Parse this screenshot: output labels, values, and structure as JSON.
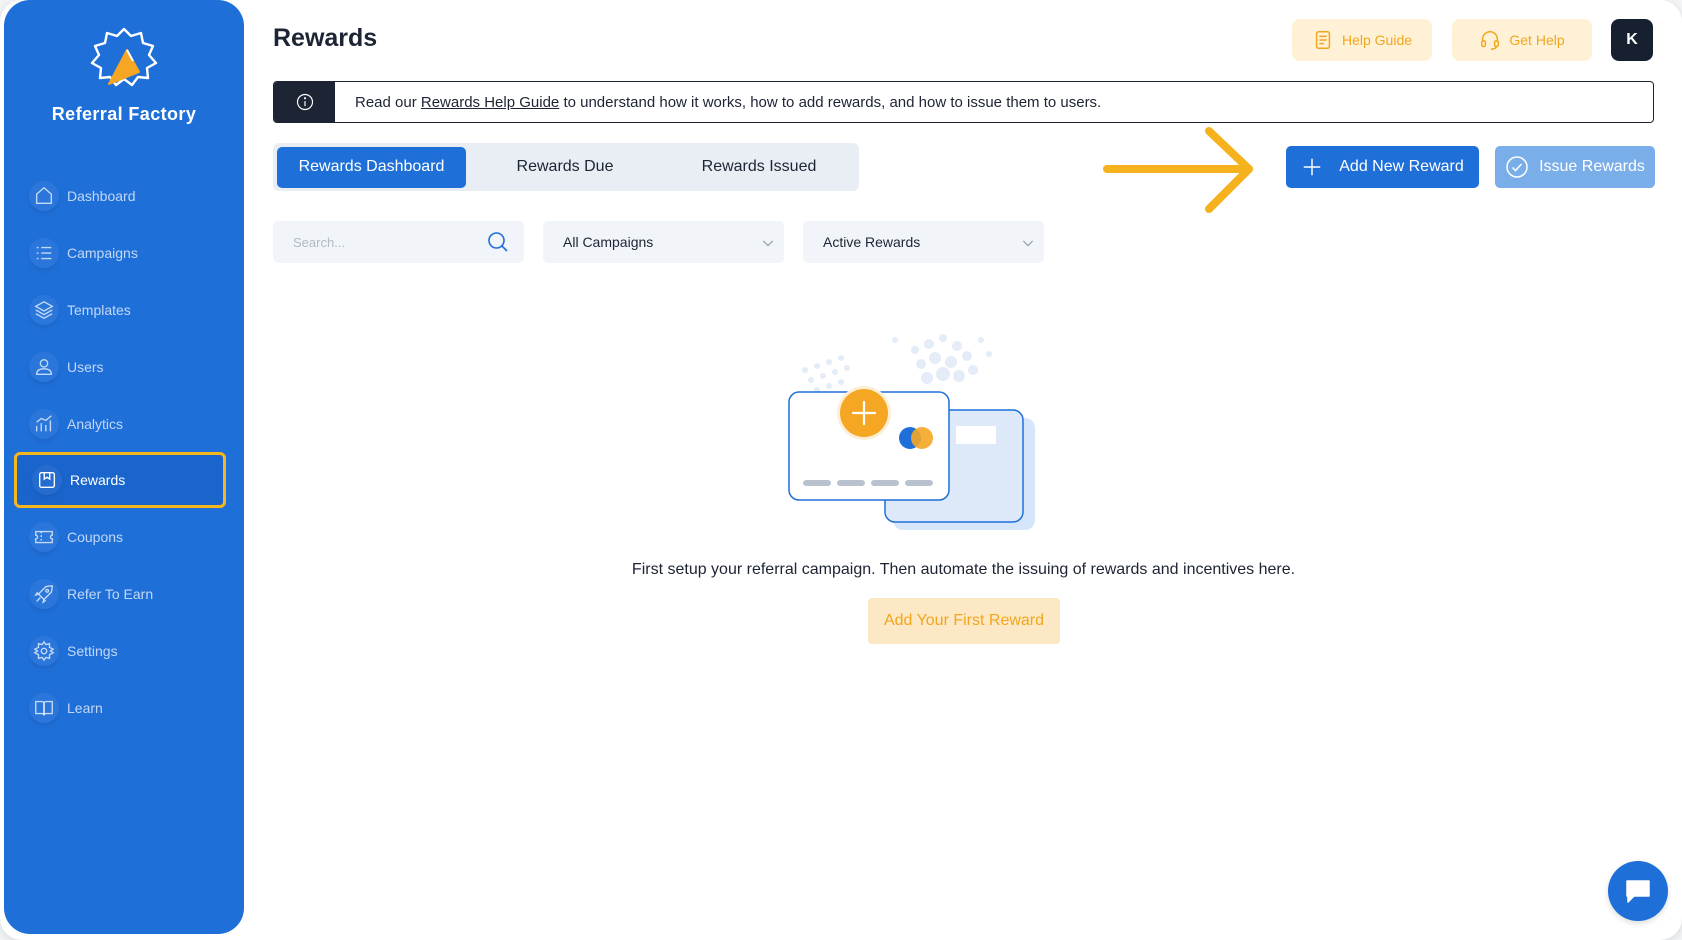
{
  "sidebar": {
    "brand": "Referral Factory",
    "items": [
      {
        "label": "Dashboard",
        "icon": "home-icon"
      },
      {
        "label": "Campaigns",
        "icon": "list-icon"
      },
      {
        "label": "Templates",
        "icon": "layers-icon"
      },
      {
        "label": "Users",
        "icon": "user-icon"
      },
      {
        "label": "Analytics",
        "icon": "chart-icon"
      },
      {
        "label": "Rewards",
        "icon": "gift-box-icon",
        "active": true
      },
      {
        "label": "Coupons",
        "icon": "ticket-icon"
      },
      {
        "label": "Refer To Earn",
        "icon": "rocket-icon"
      },
      {
        "label": "Settings",
        "icon": "gear-icon"
      },
      {
        "label": "Learn",
        "icon": "book-icon"
      }
    ]
  },
  "header": {
    "title": "Rewards",
    "help_guide": "Help Guide",
    "get_help": "Get Help",
    "avatar_initial": "K"
  },
  "info": {
    "prefix": "Read our ",
    "link": "Rewards Help Guide",
    "suffix": " to understand how it works, how to add rewards, and how to issue them to users."
  },
  "tabs": [
    {
      "label": "Rewards Dashboard",
      "active": true
    },
    {
      "label": "Rewards Due",
      "active": false
    },
    {
      "label": "Rewards Issued",
      "active": false
    }
  ],
  "actions": {
    "add_new_reward": "Add New Reward",
    "issue_rewards": "Issue Rewards"
  },
  "filters": {
    "search_placeholder": "Search...",
    "campaign_select": "All Campaigns",
    "status_select": "Active Rewards"
  },
  "empty_state": {
    "message": "First setup your referral campaign. Then automate the issuing of rewards and incentives here.",
    "button": "Add Your First Reward"
  },
  "colors": {
    "primary": "#1f6fd9",
    "accent": "#f5b81c",
    "dark": "#1d2433"
  }
}
